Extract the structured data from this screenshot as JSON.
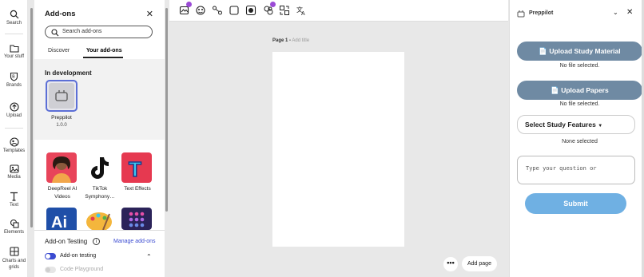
{
  "rail": {
    "items": [
      {
        "label": "Search",
        "icon": "search-icon"
      },
      {
        "label": "Your stuff",
        "icon": "folder-icon"
      },
      {
        "label": "Brands",
        "icon": "brand-icon"
      },
      {
        "label": "Upload",
        "icon": "upload-icon"
      },
      {
        "label": "Templates",
        "icon": "templates-icon"
      },
      {
        "label": "Media",
        "icon": "media-icon"
      },
      {
        "label": "Text",
        "icon": "text-icon"
      },
      {
        "label": "Elements",
        "icon": "elements-icon"
      },
      {
        "label": "Charts and grids",
        "icon": "charts-icon"
      }
    ]
  },
  "addons": {
    "title": "Add-ons",
    "search_placeholder": "Search add-ons",
    "tabs": [
      {
        "label": "Discover"
      },
      {
        "label": "Your add-ons"
      }
    ],
    "in_development_title": "In development",
    "dev_addon": {
      "name": "Preppilot",
      "version": "1.0.0"
    },
    "tiles": [
      {
        "label_1": "DeepReel AI",
        "label_2": "Videos",
        "color": "#e8445a"
      },
      {
        "label_1": "TikTok",
        "label_2": "Symphony…",
        "color": "#ffffff"
      },
      {
        "label_1": "Text Effects",
        "label_2": "",
        "color": "#e63950"
      },
      {
        "label_1": "",
        "label_2": "",
        "color": "#1f4fa8"
      },
      {
        "label_1": "",
        "label_2": "",
        "color": "#f4b63c"
      },
      {
        "label_1": "",
        "label_2": "",
        "color": "#2b2359"
      }
    ],
    "testing_title": "Add-on Testing",
    "manage_link": "Manage add-ons",
    "addon_testing_label": "Add-on testing",
    "code_playground_label": "Code Playground"
  },
  "canvas": {
    "page_label": "Page 1 -",
    "add_title": "Add title",
    "more_label": "•••",
    "add_page": "Add page"
  },
  "preppilot": {
    "title": "Preppilot",
    "upload_material": "Upload Study Material",
    "material_status": "No file selected.",
    "upload_papers": "Upload Papers",
    "papers_status": "No file selected.",
    "select_features": "Select Study Features",
    "features_status": "None selected",
    "question_placeholder": "Type your question or",
    "submit": "Submit"
  },
  "colors": {
    "accent": "#5c6fd6",
    "toggle_on": "#3b4bd1",
    "button": "#6f8aa3",
    "submit": "#6fb0e3",
    "badge": "#9b4bd6"
  }
}
